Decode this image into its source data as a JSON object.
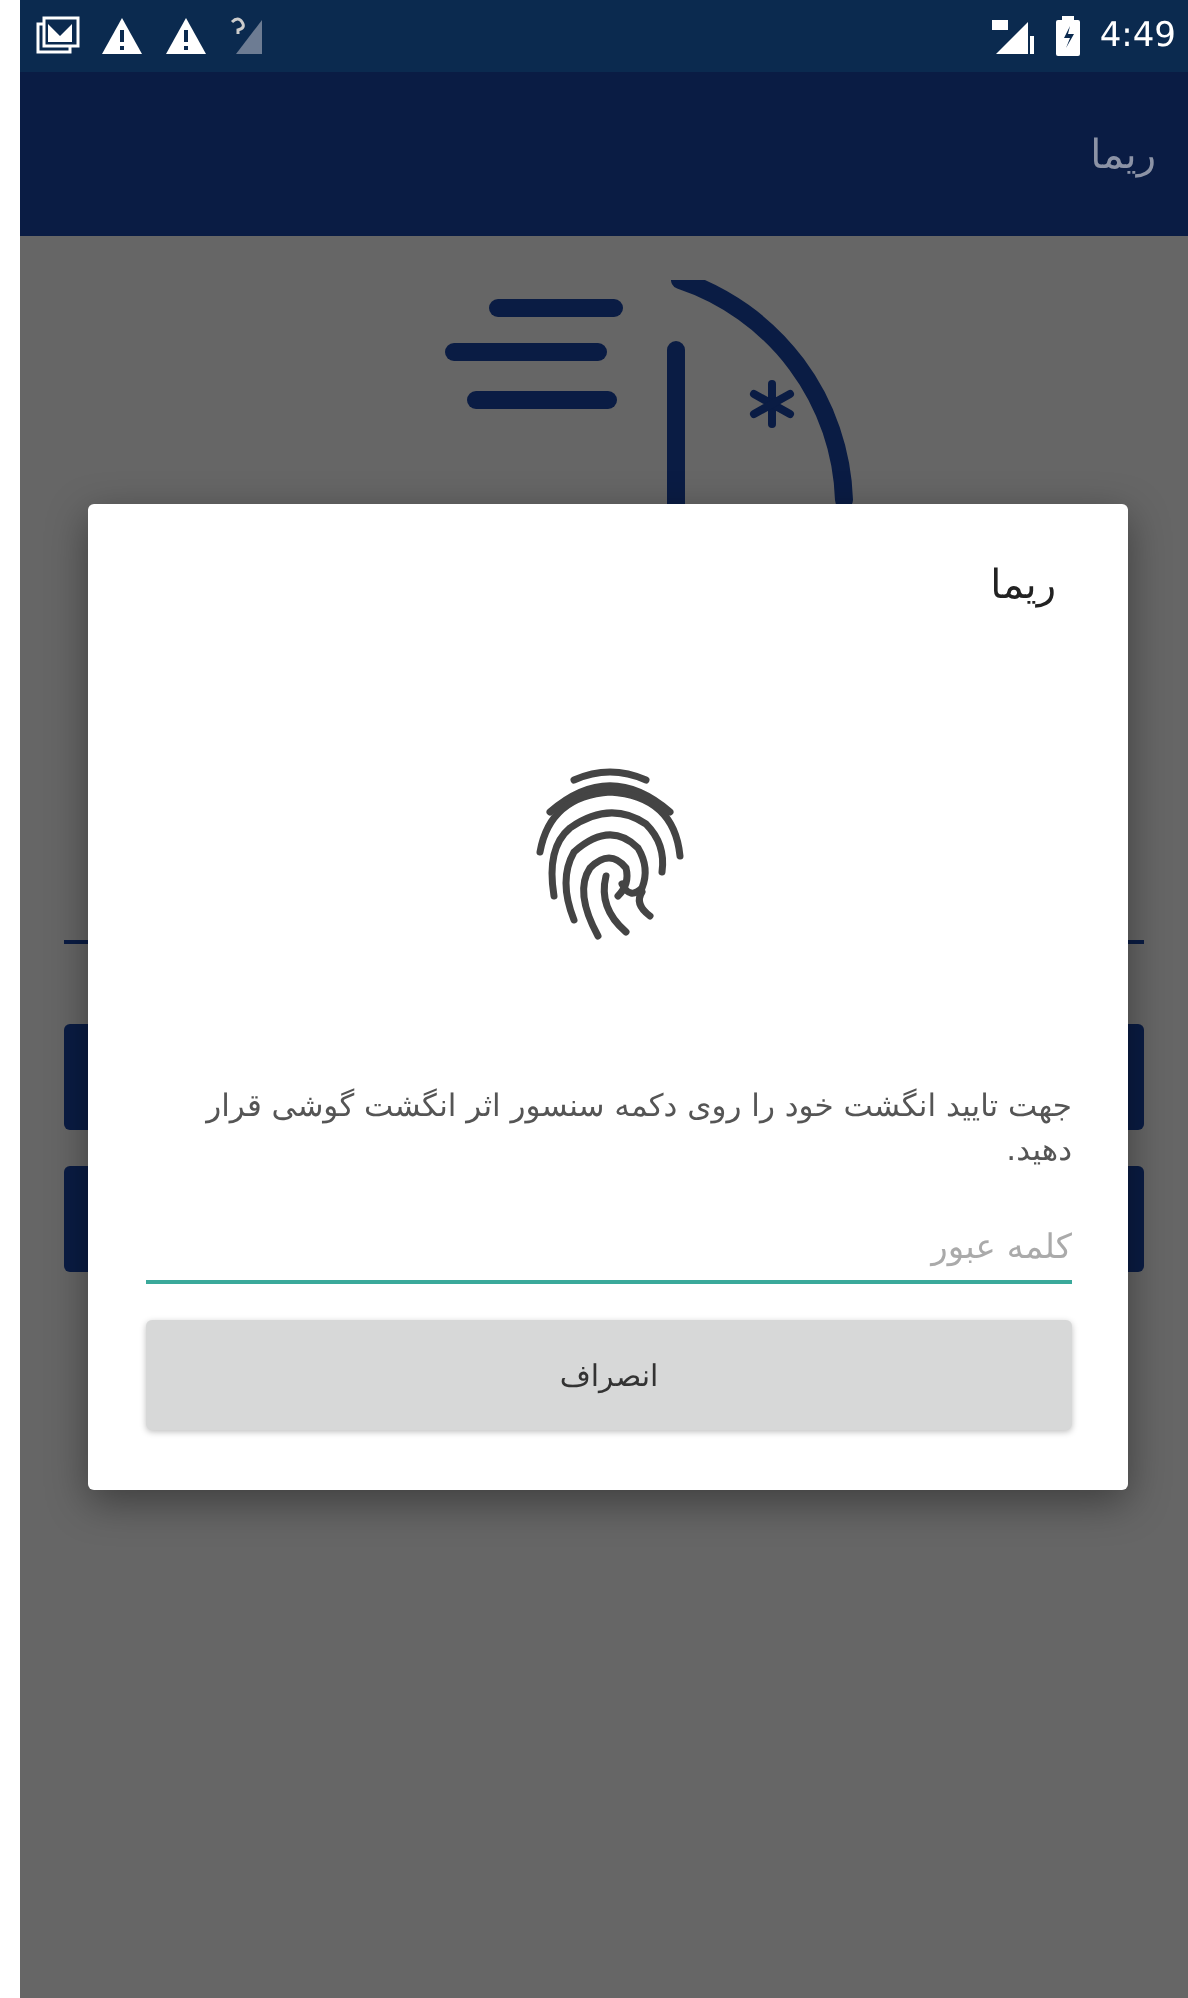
{
  "status_bar": {
    "time": "4:49"
  },
  "app_bar": {
    "title": "ریما"
  },
  "dialog": {
    "title": "ریما",
    "message": "جهت تایید انگشت خود را روی دکمه سنسور اثر انگشت گوشی قرار دهید.",
    "password_field": {
      "placeholder": "کلمه عبور",
      "focused": true
    },
    "buttons": [
      {
        "label": "انصراف"
      }
    ]
  }
}
